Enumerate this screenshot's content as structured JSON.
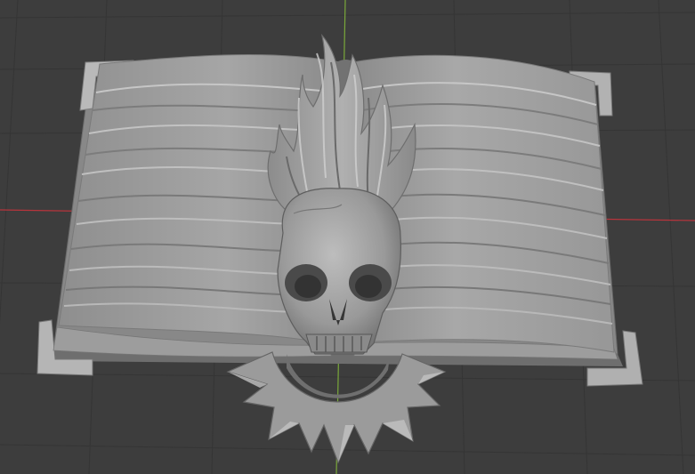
{
  "viewport": {
    "background_color": "#3d3d3d",
    "grid_color": "#343434",
    "x_axis_color": "#b8343c",
    "y_axis_color": "#7aa83a"
  },
  "model": {
    "base_color": "#9a9a9a",
    "light_color": "#c4c4c4",
    "shadow_color": "#6c6c6c",
    "icons": [
      "open-book-icon",
      "flaming-skull-icon",
      "spiked-sun-icon"
    ]
  }
}
